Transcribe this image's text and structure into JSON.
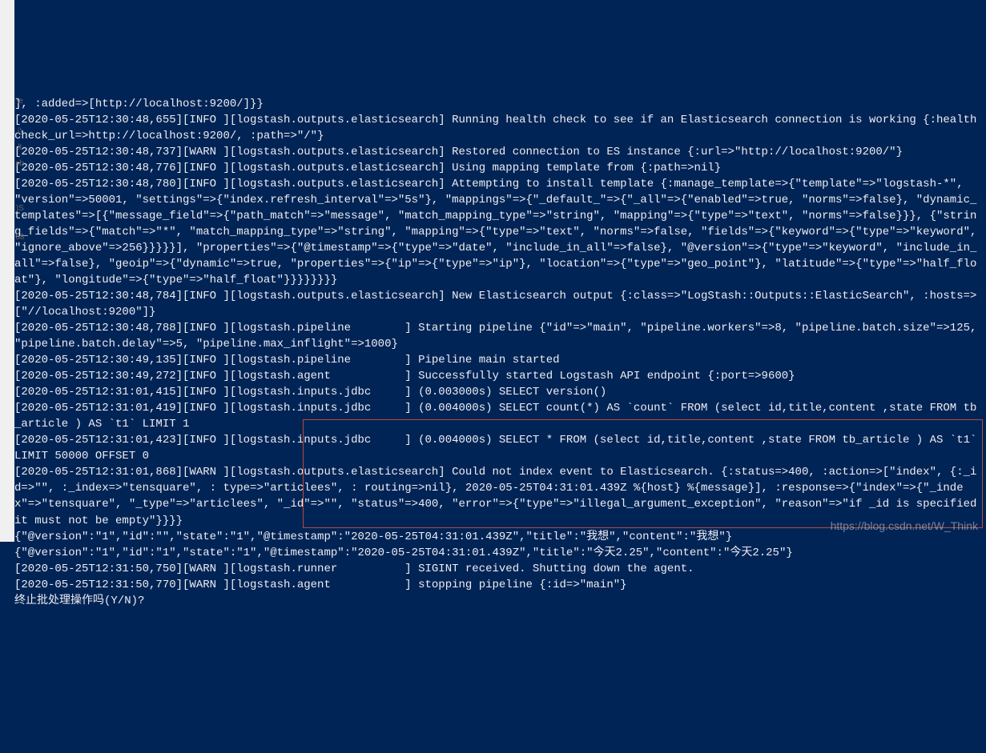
{
  "gutter": {
    "items": [
      "\\e",
      "i)",
      "lt",
      "sh",
      ")S",
      "88"
    ]
  },
  "terminal": {
    "lines": [
      "], :added=>[http://localhost:9200/]}}",
      "[2020-05-25T12:30:48,655][INFO ][logstash.outputs.elasticsearch] Running health check to see if an Elasticsearch connection is working {:healthcheck_url=>http://localhost:9200/, :path=>\"/\"}",
      "[2020-05-25T12:30:48,737][WARN ][logstash.outputs.elasticsearch] Restored connection to ES instance {:url=>\"http://localhost:9200/\"}",
      "[2020-05-25T12:30:48,776][INFO ][logstash.outputs.elasticsearch] Using mapping template from {:path=>nil}",
      "[2020-05-25T12:30:48,780][INFO ][logstash.outputs.elasticsearch] Attempting to install template {:manage_template=>{\"template\"=>\"logstash-*\", \"version\"=>50001, \"settings\"=>{\"index.refresh_interval\"=>\"5s\"}, \"mappings\"=>{\"_default_\"=>{\"_all\"=>{\"enabled\"=>true, \"norms\"=>false}, \"dynamic_templates\"=>[{\"message_field\"=>{\"path_match\"=>\"message\", \"match_mapping_type\"=>\"string\", \"mapping\"=>{\"type\"=>\"text\", \"norms\"=>false}}}, {\"string_fields\"=>{\"match\"=>\"*\", \"match_mapping_type\"=>\"string\", \"mapping\"=>{\"type\"=>\"text\", \"norms\"=>false, \"fields\"=>{\"keyword\"=>{\"type\"=>\"keyword\", \"ignore_above\"=>256}}}}}], \"properties\"=>{\"@timestamp\"=>{\"type\"=>\"date\", \"include_in_all\"=>false}, \"@version\"=>{\"type\"=>\"keyword\", \"include_in_all\"=>false}, \"geoip\"=>{\"dynamic\"=>true, \"properties\"=>{\"ip\"=>{\"type\"=>\"ip\"}, \"location\"=>{\"type\"=>\"geo_point\"}, \"latitude\"=>{\"type\"=>\"half_float\"}, \"longitude\"=>{\"type\"=>\"half_float\"}}}}}}}}",
      "[2020-05-25T12:30:48,784][INFO ][logstash.outputs.elasticsearch] New Elasticsearch output {:class=>\"LogStash::Outputs::ElasticSearch\", :hosts=>[\"//localhost:9200\"]}",
      "[2020-05-25T12:30:48,788][INFO ][logstash.pipeline        ] Starting pipeline {\"id\"=>\"main\", \"pipeline.workers\"=>8, \"pipeline.batch.size\"=>125, \"pipeline.batch.delay\"=>5, \"pipeline.max_inflight\"=>1000}",
      "[2020-05-25T12:30:49,135][INFO ][logstash.pipeline        ] Pipeline main started",
      "[2020-05-25T12:30:49,272][INFO ][logstash.agent           ] Successfully started Logstash API endpoint {:port=>9600}",
      "[2020-05-25T12:31:01,415][INFO ][logstash.inputs.jdbc     ] (0.003000s) SELECT version()",
      "[2020-05-25T12:31:01,419][INFO ][logstash.inputs.jdbc     ] (0.004000s) SELECT count(*) AS `count` FROM (select id,title,content ,state FROM tb_article ) AS `t1` LIMIT 1",
      "[2020-05-25T12:31:01,423][INFO ][logstash.inputs.jdbc     ] (0.004000s) SELECT * FROM (select id,title,content ,state FROM tb_article ) AS `t1`  LIMIT 50000 OFFSET 0",
      "[2020-05-25T12:31:01,868][WARN ][logstash.outputs.elasticsearch] Could not index event to Elasticsearch. {:status=>400, :action=>[\"index\", {:_id=>\"\", :_index=>\"tensquare\", : type=>\"articlees\", : routing=>nil}, 2020-05-25T04:31:01.439Z %{host} %{message}], :response=>{\"index\"=>{\"_index\"=>\"tensquare\", \"_type\"=>\"articlees\", \"_id\"=>\"\", \"status\"=>400, \"error\"=>{\"type\"=>\"illegal_argument_exception\", \"reason\"=>\"if _id is specified it must not be empty\"}}}}",
      "{\"@version\":\"1\",\"id\":\"\",\"state\":\"1\",\"@timestamp\":\"2020-05-25T04:31:01.439Z\",\"title\":\"我想\",\"content\":\"我想\"}",
      "{\"@version\":\"1\",\"id\":\"1\",\"state\":\"1\",\"@timestamp\":\"2020-05-25T04:31:01.439Z\",\"title\":\"今天2.25\",\"content\":\"今天2.25\"}",
      "[2020-05-25T12:31:50,750][WARN ][logstash.runner          ] SIGINT received. Shutting down the agent.",
      "[2020-05-25T12:31:50,770][WARN ][logstash.agent           ] stopping pipeline {:id=>\"main\"}",
      "终止批处理操作吗(Y/N)? "
    ]
  },
  "watermark": "https://blog.csdn.net/W_Think"
}
